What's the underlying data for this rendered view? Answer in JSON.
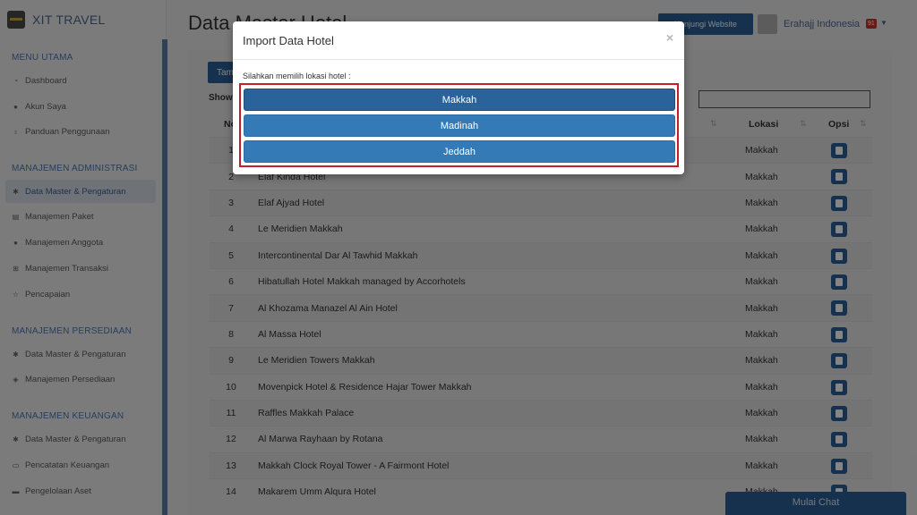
{
  "brand": {
    "name": "XIT TRAVEL"
  },
  "sidebar": {
    "sections": [
      {
        "title": "MENU UTAMA",
        "items": [
          "Dashboard",
          "Akun Saya",
          "Panduan Penggunaan"
        ]
      },
      {
        "title": "MANAJEMEN ADMINISTRASI",
        "items": [
          "Data Master & Pengaturan",
          "Manajemen Paket",
          "Manajemen Anggota",
          "Manajemen Transaksi",
          "Pencapaian"
        ]
      },
      {
        "title": "MANAJEMEN PERSEDIAAN",
        "items": [
          "Data Master & Pengaturan",
          "Manajemen Persediaan"
        ]
      },
      {
        "title": "MANAJEMEN KEUANGAN",
        "items": [
          "Data Master & Pengaturan",
          "Pencatatan Keuangan",
          "Pengelolaan Aset"
        ]
      }
    ]
  },
  "header": {
    "page_title": "Data Master Hotel",
    "visit_website": "Kunjungi Website",
    "user_name": "Erahajj Indonesia",
    "notif_count": "91"
  },
  "toolbar": {
    "add_label": "Tambah",
    "show_label": "Show"
  },
  "table": {
    "headers": {
      "no": "No",
      "lokasi": "Lokasi",
      "opsi": "Opsi"
    },
    "rows": [
      {
        "no": "1",
        "nama": "",
        "lokasi": "Makkah"
      },
      {
        "no": "2",
        "nama": "Elaf Kinda Hotel",
        "lokasi": "Makkah"
      },
      {
        "no": "3",
        "nama": "Elaf Ajyad Hotel",
        "lokasi": "Makkah"
      },
      {
        "no": "4",
        "nama": "Le Meridien Makkah",
        "lokasi": "Makkah"
      },
      {
        "no": "5",
        "nama": "Intercontinental Dar Al Tawhid Makkah",
        "lokasi": "Makkah"
      },
      {
        "no": "6",
        "nama": "Hibatullah Hotel Makkah managed by Accorhotels",
        "lokasi": "Makkah"
      },
      {
        "no": "7",
        "nama": "Al Khozama Manazel Al Ain Hotel",
        "lokasi": "Makkah"
      },
      {
        "no": "8",
        "nama": "Al Massa Hotel",
        "lokasi": "Makkah"
      },
      {
        "no": "9",
        "nama": "Le Meridien Towers Makkah",
        "lokasi": "Makkah"
      },
      {
        "no": "10",
        "nama": "Movenpick Hotel & Residence Hajar Tower Makkah",
        "lokasi": "Makkah"
      },
      {
        "no": "11",
        "nama": "Raffles Makkah Palace",
        "lokasi": "Makkah"
      },
      {
        "no": "12",
        "nama": "Al Marwa Rayhaan by Rotana",
        "lokasi": "Makkah"
      },
      {
        "no": "13",
        "nama": "Makkah Clock Royal Tower - A Fairmont Hotel",
        "lokasi": "Makkah"
      },
      {
        "no": "14",
        "nama": "Makarem Umm Alqura Hotel",
        "lokasi": "Makkah"
      }
    ]
  },
  "modal": {
    "title": "Import Data Hotel",
    "close": "×",
    "label": "Silahkan memilih lokasi hotel :",
    "choices": [
      "Makkah",
      "Madinah",
      "Jeddah"
    ]
  },
  "chat": {
    "label": "Mulai Chat"
  }
}
